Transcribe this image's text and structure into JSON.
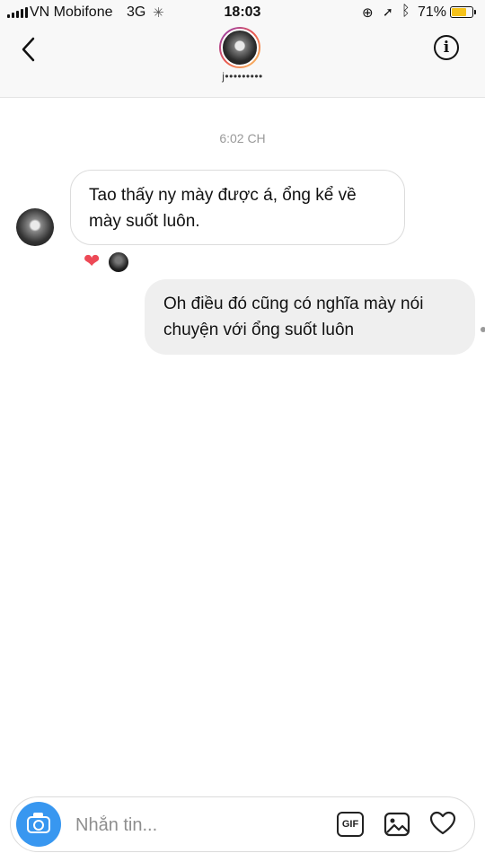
{
  "status_bar": {
    "carrier": "VN Mobifone",
    "network": "3G",
    "time": "18:03",
    "battery_percent": "71%",
    "battery_level": 0.71,
    "icons": [
      "signal-bars-icon",
      "loading-spinner-icon",
      "rotation-lock-icon",
      "location-arrow-icon",
      "bluetooth-icon",
      "battery-icon"
    ]
  },
  "header": {
    "username": "j•••••••••",
    "icons": [
      "back-chevron-icon",
      "info-icon"
    ]
  },
  "conversation": {
    "timestamp": "6:02 CH",
    "messages": [
      {
        "direction": "received",
        "text": "Tao thấy ny mày được á, ổng kể về mày suốt luôn."
      },
      {
        "direction": "sent",
        "text": "Oh điều đó cũng có nghĩa mày nói chuyện với ổng suốt luôn"
      }
    ],
    "reactions": [
      "heart-icon"
    ]
  },
  "composer": {
    "placeholder": "Nhắn tin...",
    "gif_label": "GIF",
    "icons": [
      "camera-icon",
      "gif-icon",
      "gallery-icon",
      "heart-outline-icon"
    ]
  },
  "colors": {
    "camera_button": "#3897f0",
    "heart": "#ed4956",
    "battery": "#f5c21a",
    "sent_bubble": "#efefef"
  }
}
